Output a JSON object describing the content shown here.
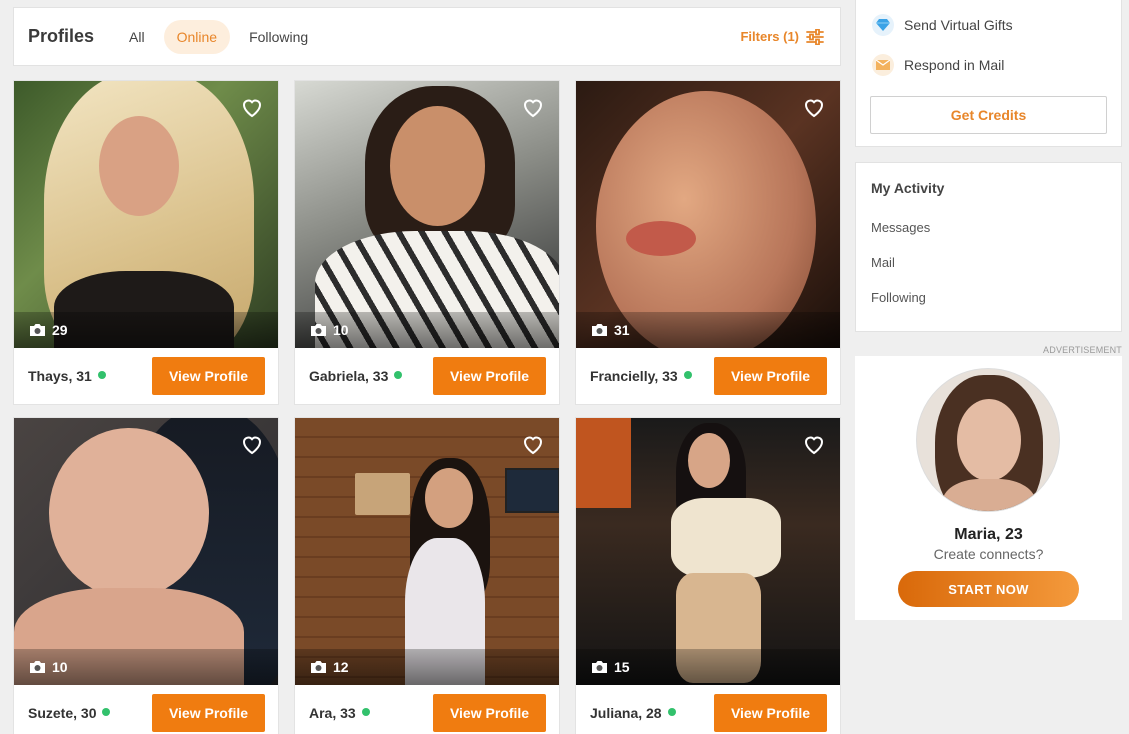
{
  "header": {
    "title": "Profiles",
    "tabs": [
      {
        "label": "All",
        "active": false
      },
      {
        "label": "Online",
        "active": true
      },
      {
        "label": "Following",
        "active": false
      }
    ],
    "filters_label": "Filters (1)",
    "filters_icon": "sliders-icon"
  },
  "profiles": [
    {
      "name": "Thays, 31",
      "photos": "29",
      "online": true,
      "button": "View Profile"
    },
    {
      "name": "Gabriela, 33",
      "photos": "10",
      "online": true,
      "button": "View Profile"
    },
    {
      "name": "Francielly, 33",
      "photos": "31",
      "online": true,
      "button": "View Profile"
    },
    {
      "name": "Suzete, 30",
      "photos": "10",
      "online": true,
      "button": "View Profile"
    },
    {
      "name": "Ara, 33",
      "photos": "12",
      "online": true,
      "button": "View Profile"
    },
    {
      "name": "Juliana, 28",
      "photos": "15",
      "online": true,
      "button": "View Profile"
    }
  ],
  "sidebar": {
    "credits": {
      "items": [
        {
          "label": "Send Virtual Gifts",
          "icon": "diamond-icon"
        },
        {
          "label": "Respond in Mail",
          "icon": "envelope-icon"
        }
      ],
      "button": "Get Credits"
    },
    "activity": {
      "title": "My Activity",
      "items": [
        "Messages",
        "Mail",
        "Following"
      ]
    },
    "ad": {
      "label": "ADVERTISEMENT",
      "name": "Maria, 23",
      "subtitle": "Create connects?",
      "button": "START NOW"
    }
  },
  "colors": {
    "accent": "#f07c10",
    "online": "#32c16c",
    "tab_active_bg": "#fdeedd"
  }
}
